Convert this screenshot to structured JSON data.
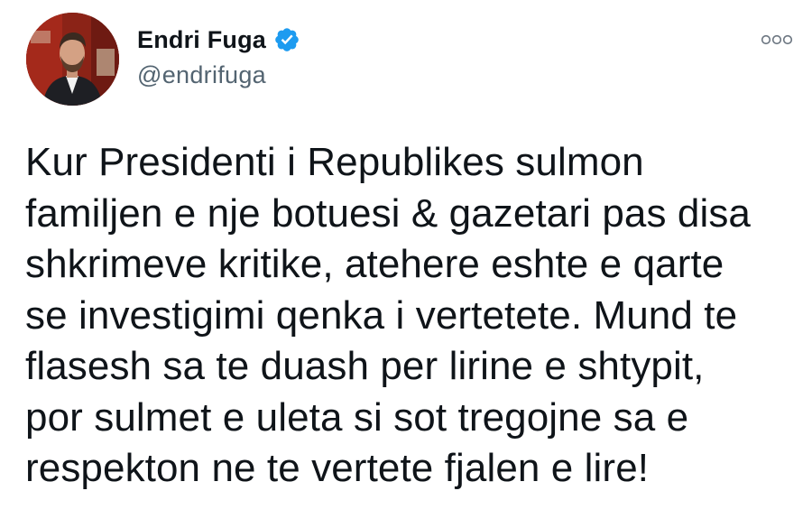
{
  "tweet": {
    "author": {
      "display_name": "Endri Fuga",
      "handle": "@endrifuga",
      "verified": true,
      "avatar_icon": "profile-photo"
    },
    "more_icon": "more-options-icon",
    "text": "Kur Presidenti i Republikes sulmon\nfamiljen e nje botuesi & gazetari pas disa\nshkrimeve kritike, atehere eshte e qarte\nse investigimi qenka i vertetete. Mund te\nflasesh sa te duash per lirine e shtypit,\npor sulmet e uleta si sot tregojne sa e\nrespekton ne te vertete fjalen e lire!"
  },
  "colors": {
    "verified_badge": "#1d9bf0",
    "handle_text": "#536471",
    "body_text": "#0f1419"
  }
}
